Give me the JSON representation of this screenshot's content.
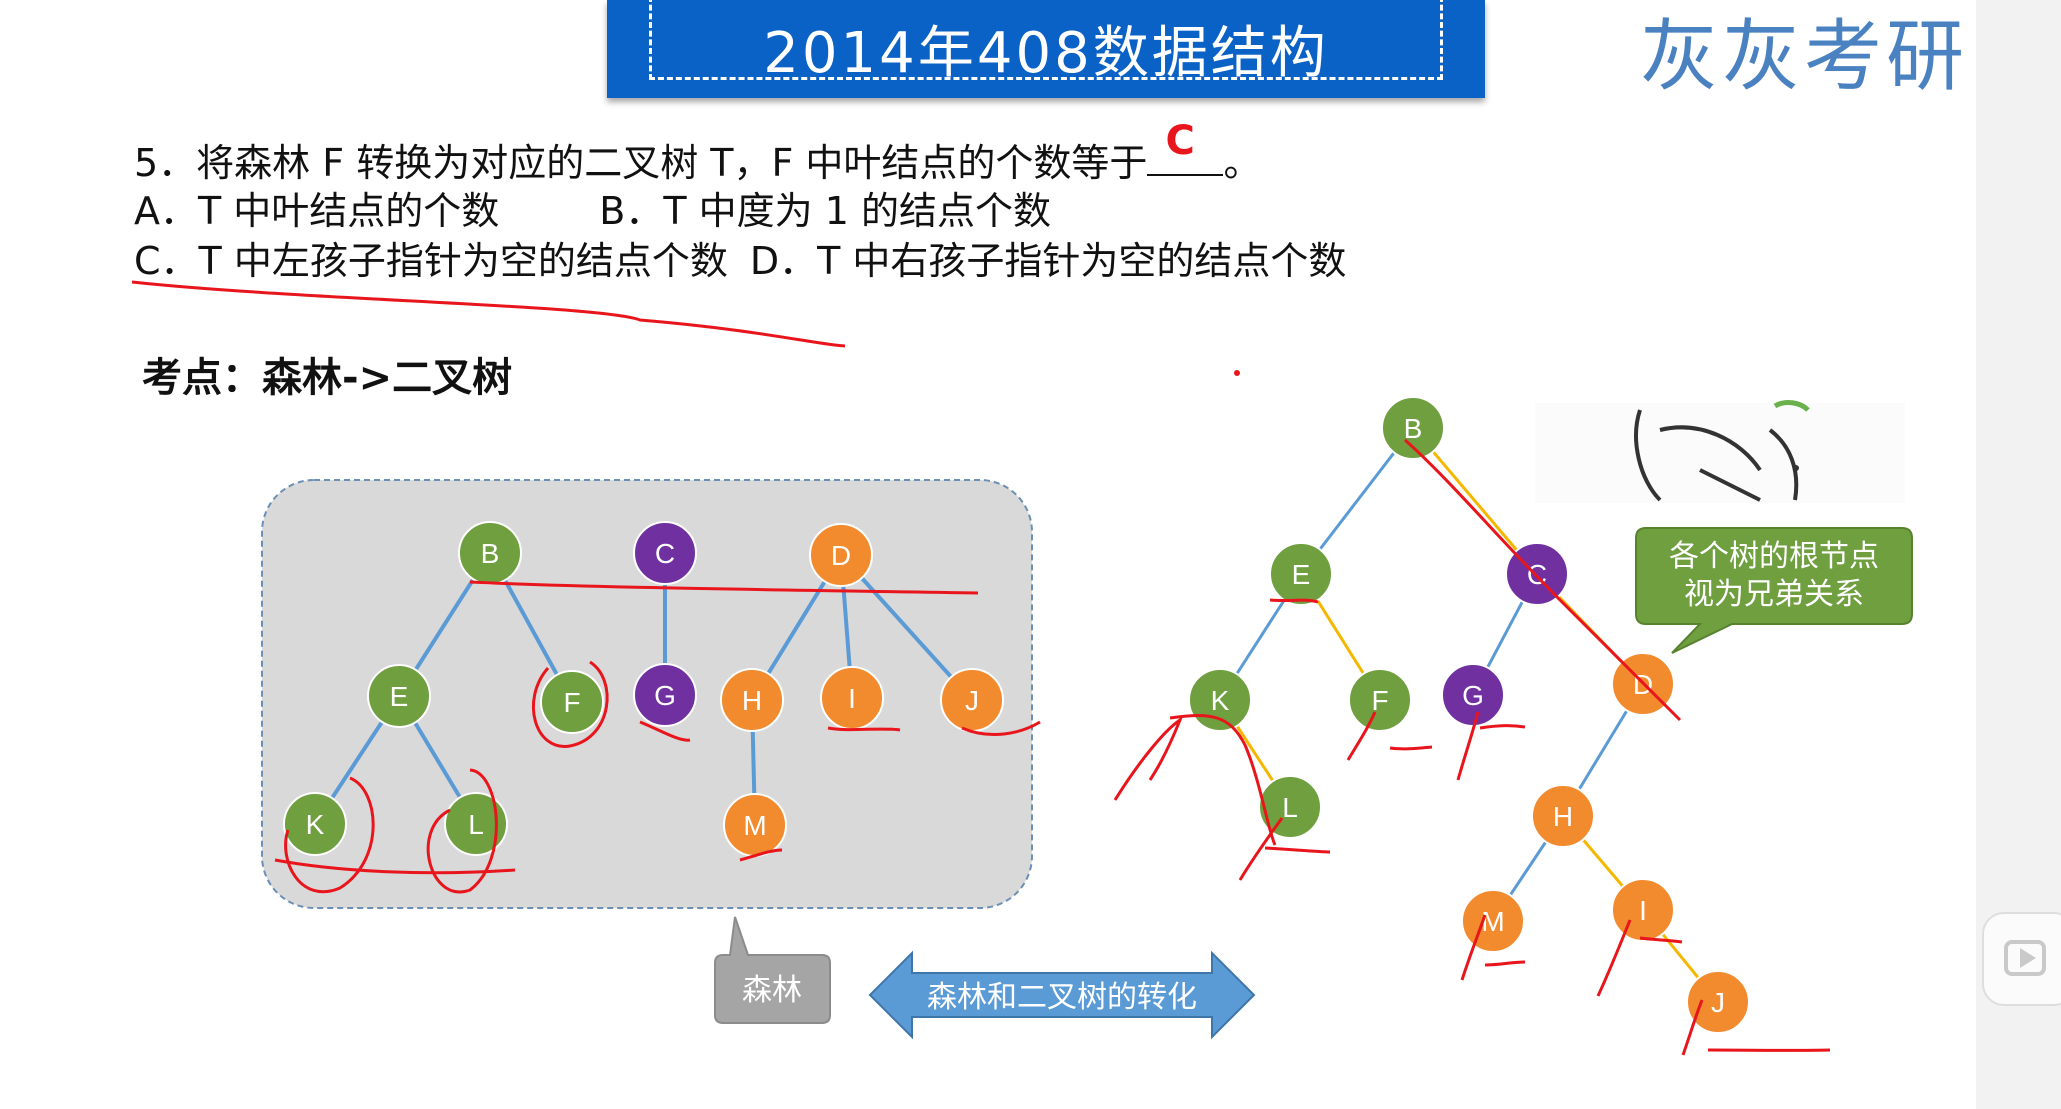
{
  "header": {
    "title": "2014年408数据结构",
    "brand": "灰灰考研"
  },
  "question": {
    "stem_prefix": "5．将森林 F 转换为对应的二叉树 T，F 中叶结点的个数等于",
    "answer": "C",
    "stem_suffix": "。",
    "options": {
      "A": "A．T 中叶结点的个数",
      "B": "B．T 中度为 1 的结点个数",
      "C": "C．T 中左孩子指针为空的结点个数",
      "D": "D．T 中右孩子指针为空的结点个数"
    }
  },
  "keypoint": "考点：森林->二叉树",
  "forest": {
    "nodes": [
      "B",
      "C",
      "D",
      "E",
      "F",
      "G",
      "H",
      "I",
      "J",
      "K",
      "L",
      "M"
    ],
    "callout": "森林"
  },
  "binary_tree": {
    "nodes": [
      "B",
      "E",
      "C",
      "K",
      "F",
      "G",
      "D",
      "L",
      "H",
      "M",
      "I",
      "J"
    ],
    "callout_line1": "各个树的根节点",
    "callout_line2": "视为兄弟关系"
  },
  "arrow_label": "森林和二叉树的转化",
  "colors": {
    "green": "#6f9f3f",
    "purple": "#7030a0",
    "orange": "#f28a2e",
    "edge_blue": "#5b9bd5",
    "edge_yellow": "#f5b800",
    "annotation_red": "#e8161c",
    "title_blue": "#0b62c6"
  }
}
